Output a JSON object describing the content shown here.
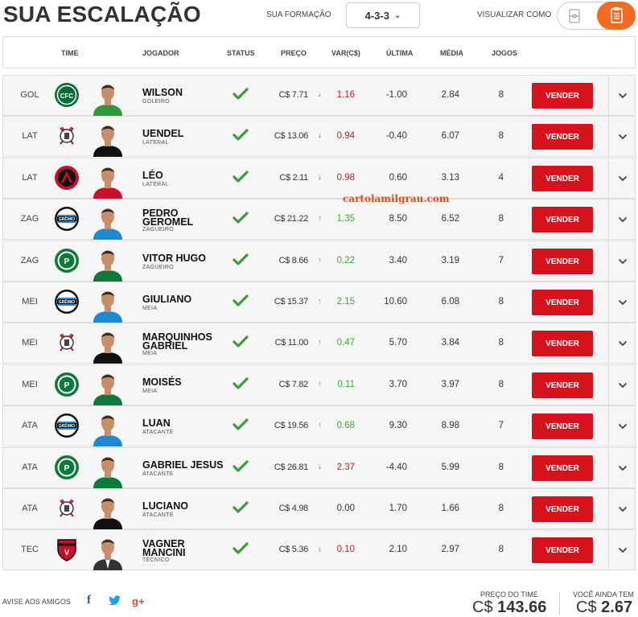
{
  "page": {
    "title": "SUA ESCALAÇÃO",
    "formacao_label": "SUA FORMAÇÃO",
    "formacao_value": "4-3-3",
    "view_label": "VISUALIZAR COMO"
  },
  "headers": {
    "time": "TIME",
    "jogador": "JOGADOR",
    "status": "STATUS",
    "preco": "PREÇO",
    "var": "VAR(C$)",
    "ultima": "ÚLTIMA",
    "media": "MÉDIA",
    "jogos": "JOGOS"
  },
  "sell_label": "VENDER",
  "players": [
    {
      "pos": "GOL",
      "club": "coritiba",
      "name1": "WILSON",
      "name2": "",
      "role": "GOLEIRO",
      "preco": "C$ 7.71",
      "var": "1.16",
      "trend": "down",
      "ultima": "-1.00",
      "media": "2.84",
      "jogos": "8"
    },
    {
      "pos": "LAT",
      "club": "corinthians",
      "name1": "UENDEL",
      "name2": "",
      "role": "LATERAL",
      "preco": "C$ 13.06",
      "var": "0.94",
      "trend": "down",
      "ultima": "-0.40",
      "media": "6.07",
      "jogos": "8"
    },
    {
      "pos": "LAT",
      "club": "atletico-pr",
      "name1": "LÉO",
      "name2": "",
      "role": "LATERAL",
      "preco": "C$ 2.11",
      "var": "0.98",
      "trend": "down",
      "ultima": "0.60",
      "media": "3.13",
      "jogos": "4"
    },
    {
      "pos": "ZAG",
      "club": "gremio",
      "name1": "PEDRO",
      "name2": "GEROMEL",
      "role": "ZAGUEIRO",
      "preco": "C$ 21.22",
      "var": "1.35",
      "trend": "up",
      "ultima": "8.50",
      "media": "6.52",
      "jogos": "8"
    },
    {
      "pos": "ZAG",
      "club": "palmeiras",
      "name1": "VITOR HUGO",
      "name2": "",
      "role": "ZAGUEIRO",
      "preco": "C$ 8.66",
      "var": "0.22",
      "trend": "up",
      "ultima": "3.40",
      "media": "3.19",
      "jogos": "7"
    },
    {
      "pos": "MEI",
      "club": "gremio",
      "name1": "GIULIANO",
      "name2": "",
      "role": "MEIA",
      "preco": "C$ 15.37",
      "var": "2.15",
      "trend": "up",
      "ultima": "10.60",
      "media": "6.08",
      "jogos": "8"
    },
    {
      "pos": "MEI",
      "club": "corinthians",
      "name1": "MARQUINHOS",
      "name2": "GABRIEL",
      "role": "MEIA",
      "preco": "C$ 11.00",
      "var": "0.47",
      "trend": "up",
      "ultima": "5.70",
      "media": "3.84",
      "jogos": "8"
    },
    {
      "pos": "MEI",
      "club": "palmeiras",
      "name1": "MOISÉS",
      "name2": "",
      "role": "MEIA",
      "preco": "C$ 7.82",
      "var": "0.11",
      "trend": "up",
      "ultima": "3.70",
      "media": "3.97",
      "jogos": "8"
    },
    {
      "pos": "ATA",
      "club": "gremio",
      "name1": "LUAN",
      "name2": "",
      "role": "ATACANTE",
      "preco": "C$ 19.56",
      "var": "0.68",
      "trend": "up",
      "ultima": "9.30",
      "media": "8.98",
      "jogos": "7"
    },
    {
      "pos": "ATA",
      "club": "palmeiras",
      "name1": "GABRIEL JESUS",
      "name2": "",
      "role": "ATACANTE",
      "preco": "C$ 26.81",
      "var": "2.37",
      "trend": "down",
      "ultima": "-4.40",
      "media": "5.99",
      "jogos": "8"
    },
    {
      "pos": "ATA",
      "club": "corinthians",
      "name1": "LUCIANO",
      "name2": "",
      "role": "ATACANTE",
      "preco": "C$ 4.98",
      "var": "0.00",
      "trend": "none",
      "ultima": "1.70",
      "media": "1.66",
      "jogos": "8"
    },
    {
      "pos": "TEC",
      "club": "vitoria",
      "name1": "VAGNER",
      "name2": "MANCINI",
      "role": "TÉCNICO",
      "preco": "C$ 5.36",
      "var": "0.10",
      "trend": "down",
      "ultima": "2.10",
      "media": "2.97",
      "jogos": "8"
    }
  ],
  "watermark": "cartolamilgrau.com",
  "footer": {
    "share_label": "AVISE AOS AMIGOS",
    "facebook": "f",
    "twitter": "twitter-icon",
    "gplus": "g+",
    "preco_time_label": "PREÇO DO TIME",
    "preco_time_currency": "C$",
    "preco_time_value": "143.66",
    "ainda_tem_label": "VOCÊ AINDA TEM",
    "ainda_tem_currency": "C$",
    "ainda_tem_value": "2.67"
  },
  "colors": {
    "accent": "#f16c22",
    "sell": "#d7121d",
    "up": "#3aaa35",
    "down": "#d7121d",
    "check": "#3d9a3d"
  }
}
